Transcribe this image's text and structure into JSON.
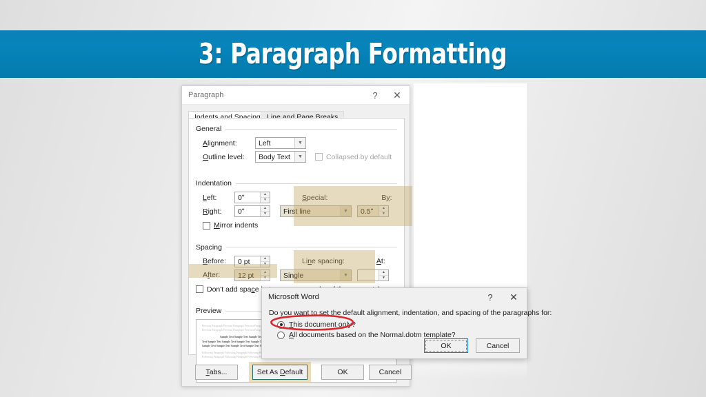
{
  "slide": {
    "title": "3: Paragraph Formatting",
    "banner_color": "#0684bb",
    "background_color": "#ececec"
  },
  "paragraph_dialog": {
    "title": "Paragraph",
    "help_icon": "?",
    "close_icon": "✕",
    "tabs": [
      {
        "label_pre": "I",
        "label_post": "ndents and Spacing",
        "active": true
      },
      {
        "label_pre": "Line and ",
        "label_accent": "P",
        "label_post": "age Breaks",
        "active": false
      }
    ],
    "tab1_label": "Indents and Spacing",
    "tab2_label": "Line and Page Breaks",
    "general": {
      "group_title": "General",
      "alignment_label": "Alignment:",
      "alignment_value": "Left",
      "outline_label": "Outline level:",
      "outline_value": "Body Text",
      "collapsed_label": "Collapsed by default",
      "collapsed_checked": false
    },
    "indentation": {
      "group_title": "Indentation",
      "left_label": "Left:",
      "left_value": "0ʺ",
      "right_label": "Right:",
      "right_value": "0ʺ",
      "special_label": "Special:",
      "special_value": "First line",
      "by_label": "By:",
      "by_value": "0.5ʺ",
      "mirror_label": "Mirror indents",
      "mirror_checked": false,
      "highlighted": true
    },
    "spacing": {
      "group_title": "Spacing",
      "before_label": "Before:",
      "before_value": "0 pt",
      "after_label": "After:",
      "after_value": "12 pt",
      "line_spacing_label": "Line spacing:",
      "line_spacing_value": "Single",
      "at_label": "At:",
      "at_value": "",
      "dont_add_label": "Don't add space between paragraphs of the same style",
      "dont_add_checked": false
    },
    "preview": {
      "group_title": "Preview",
      "previous_lines": [
        "Previous Paragraph Previous Paragraph Previous Paragraph Previous Paragraph Previous Paragraph",
        "Previous Paragraph Previous Paragraph Previous Paragraph Previous Paragraph Previous Paragraph"
      ],
      "sample_lines": [
        "Sample Text Sample Text Sample Text Sample Text Sample Text Sample",
        "Text Sample Text Sample Text Sample Text Sample Text Sample Text Sample Text",
        "Sample Text Sample Text Sample Text Sample Text Sample Text Sample Text"
      ],
      "following_lines": [
        "Following Paragraph Following Paragraph Following Paragraph Following Paragraph",
        "Following Paragraph Following Paragraph Following Paragraph Following Paragraph"
      ]
    },
    "buttons": {
      "tabs_label": "Tabs...",
      "set_as_default_label": "Set As Default",
      "set_as_default_highlighted": true,
      "ok_label": "OK",
      "cancel_label": "Cancel"
    }
  },
  "word_dialog": {
    "title": "Microsoft Word",
    "help_icon": "?",
    "close_icon": "✕",
    "question": "Do you want to set the default alignment, indentation, and spacing of the paragraphs for:",
    "options": [
      {
        "label": "This document only?",
        "selected": true
      },
      {
        "label": "All documents based on the Normal.dotm template?",
        "selected": false
      }
    ],
    "ok_label": "OK",
    "cancel_label": "Cancel",
    "ok_focused": true
  },
  "annotations": {
    "ellipse_color": "#d9272e",
    "ellipse_target": "This document only?"
  }
}
